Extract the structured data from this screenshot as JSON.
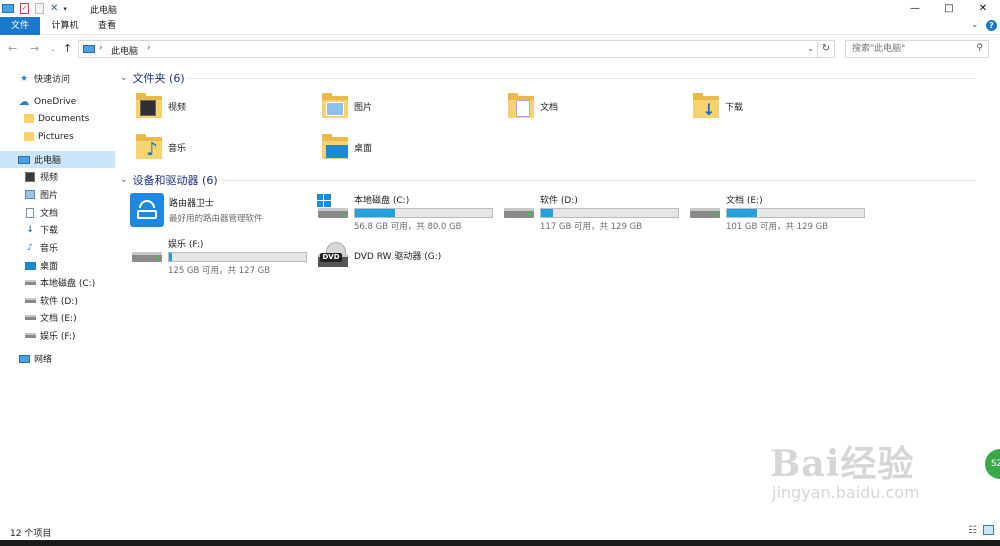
{
  "window": {
    "title": "此电脑",
    "controls": {
      "minimize": "—",
      "maximize": "□",
      "close": "✕"
    }
  },
  "ribbon": {
    "tabs": [
      "文件",
      "计算机",
      "查看"
    ]
  },
  "address": {
    "path": "此电脑",
    "search_placeholder": "搜索\"此电脑\""
  },
  "sidebar": {
    "items": [
      {
        "label": "快速访问",
        "icon": "star-icon"
      },
      {
        "label": "OneDrive",
        "icon": "cloud-icon"
      },
      {
        "label": "Documents",
        "icon": "folder-icon"
      },
      {
        "label": "Pictures",
        "icon": "folder-icon"
      },
      {
        "label": "此电脑",
        "icon": "computer-icon"
      },
      {
        "label": "视频",
        "icon": "video-icon"
      },
      {
        "label": "图片",
        "icon": "picture-icon"
      },
      {
        "label": "文档",
        "icon": "document-icon"
      },
      {
        "label": "下载",
        "icon": "download-icon"
      },
      {
        "label": "音乐",
        "icon": "music-icon"
      },
      {
        "label": "桌面",
        "icon": "desktop-icon"
      },
      {
        "label": "本地磁盘 (C:)",
        "icon": "drive-icon"
      },
      {
        "label": "软件 (D:)",
        "icon": "drive-icon"
      },
      {
        "label": "文档 (E:)",
        "icon": "drive-icon"
      },
      {
        "label": "娱乐 (F:)",
        "icon": "drive-icon"
      },
      {
        "label": "网络",
        "icon": "network-icon"
      }
    ]
  },
  "folders": {
    "header": "文件夹 (6)",
    "items": [
      {
        "name": "视频",
        "icon": "video-folder-icon"
      },
      {
        "name": "图片",
        "icon": "picture-folder-icon"
      },
      {
        "name": "文档",
        "icon": "document-folder-icon"
      },
      {
        "name": "下载",
        "icon": "download-folder-icon"
      },
      {
        "name": "音乐",
        "icon": "music-folder-icon"
      },
      {
        "name": "桌面",
        "icon": "desktop-folder-icon"
      }
    ]
  },
  "devices": {
    "header": "设备和驱动器 (6)",
    "router": {
      "name": "路由器卫士",
      "desc": "最好用的路由器管理软件"
    },
    "drives": [
      {
        "name": "本地磁盘 (C:)",
        "free": "56.8 GB 可用，共 80.0 GB",
        "used_fraction": 0.29
      },
      {
        "name": "软件 (D:)",
        "free": "117 GB 可用，共 129 GB",
        "used_fraction": 0.09
      },
      {
        "name": "文档 (E:)",
        "free": "101 GB 可用，共 129 GB",
        "used_fraction": 0.22
      },
      {
        "name": "娱乐 (F:)",
        "free": "125 GB 可用，共 127 GB",
        "used_fraction": 0.02
      }
    ],
    "dvd": {
      "name": "DVD RW 驱动器 (G:)",
      "label": "DVD"
    }
  },
  "status": {
    "count": "12 个项目"
  },
  "watermark": {
    "brand": "Bai经验",
    "url": "jingyan.baidu.com"
  },
  "badge": {
    "text": "SZ"
  },
  "colors": {
    "accent": "#1979ca",
    "bar": "#26a0da",
    "folder": "#f6d36e"
  }
}
